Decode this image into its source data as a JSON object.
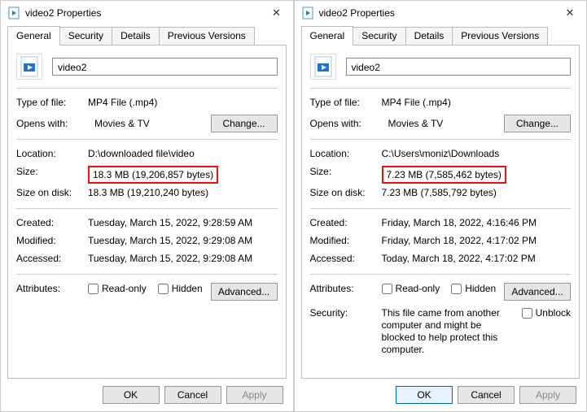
{
  "left": {
    "title": "video2 Properties",
    "tabs": [
      "General",
      "Security",
      "Details",
      "Previous Versions"
    ],
    "activeTab": 0,
    "filename": "video2",
    "typeLabel": "Type of file:",
    "typeValue": "MP4 File (.mp4)",
    "opensLabel": "Opens with:",
    "opensValue": "Movies & TV",
    "changeLabel": "Change...",
    "locationLabel": "Location:",
    "locationValue": "D:\\downloaded file\\video",
    "sizeLabel": "Size:",
    "sizeValue": "18.3 MB (19,206,857 bytes)",
    "sizeOnDiskLabel": "Size on disk:",
    "sizeOnDiskValue": "18.3 MB (19,210,240 bytes)",
    "createdLabel": "Created:",
    "createdValue": "Tuesday, March 15, 2022, 9:28:59 AM",
    "modifiedLabel": "Modified:",
    "modifiedValue": "Tuesday, March 15, 2022, 9:29:08 AM",
    "accessedLabel": "Accessed:",
    "accessedValue": "Tuesday, March 15, 2022, 9:29:08 AM",
    "attributesLabel": "Attributes:",
    "readonlyLabel": "Read-only",
    "hiddenLabel": "Hidden",
    "advancedLabel": "Advanced...",
    "okLabel": "OK",
    "cancelLabel": "Cancel",
    "applyLabel": "Apply"
  },
  "right": {
    "title": "video2 Properties",
    "tabs": [
      "General",
      "Security",
      "Details",
      "Previous Versions"
    ],
    "activeTab": 0,
    "filename": "video2",
    "typeLabel": "Type of file:",
    "typeValue": "MP4 File (.mp4)",
    "opensLabel": "Opens with:",
    "opensValue": "Movies & TV",
    "changeLabel": "Change...",
    "locationLabel": "Location:",
    "locationValue": "C:\\Users\\moniz\\Downloads",
    "sizeLabel": "Size:",
    "sizeValue": "7.23 MB (7,585,462 bytes)",
    "sizeOnDiskLabel": "Size on disk:",
    "sizeOnDiskValue": "7.23 MB (7,585,792 bytes)",
    "createdLabel": "Created:",
    "createdValue": "Friday, March 18, 2022, 4:16:46 PM",
    "modifiedLabel": "Modified:",
    "modifiedValue": "Friday, March 18, 2022, 4:17:02 PM",
    "accessedLabel": "Accessed:",
    "accessedValue": "Today, March 18, 2022, 4:17:02 PM",
    "attributesLabel": "Attributes:",
    "readonlyLabel": "Read-only",
    "hiddenLabel": "Hidden",
    "advancedLabel": "Advanced...",
    "securityLabel": "Security:",
    "securityNote": "This file came from another computer and might be blocked to help protect this computer.",
    "unblockLabel": "Unblock",
    "okLabel": "OK",
    "cancelLabel": "Cancel",
    "applyLabel": "Apply"
  }
}
